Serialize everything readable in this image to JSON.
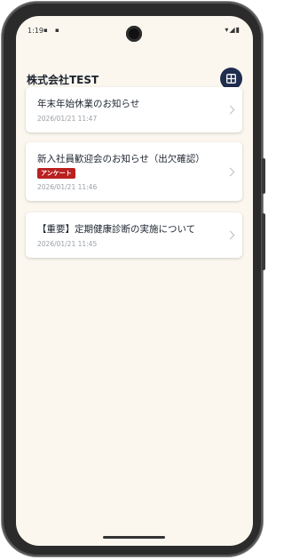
{
  "status_bar": {
    "time": "1:19",
    "left_icons": "▪ ▪",
    "right_icons": "▾◢▮"
  },
  "header": {
    "title": "株式会社TEST"
  },
  "notices": [
    {
      "title": "年末年始休業のお知らせ",
      "date": "2026/01/21 11:47",
      "badge": ""
    },
    {
      "title": "新入社員歓迎会のお知らせ（出欠確認）",
      "date": "2026/01/21 11:46",
      "badge": "アンケート"
    },
    {
      "title": "【重要】定期健康診断の実施について",
      "date": "2026/01/21 11:45",
      "badge": ""
    }
  ],
  "colors": {
    "background": "#fbf7ef",
    "accent": "#1f2d4e",
    "badge": "#b92020"
  }
}
